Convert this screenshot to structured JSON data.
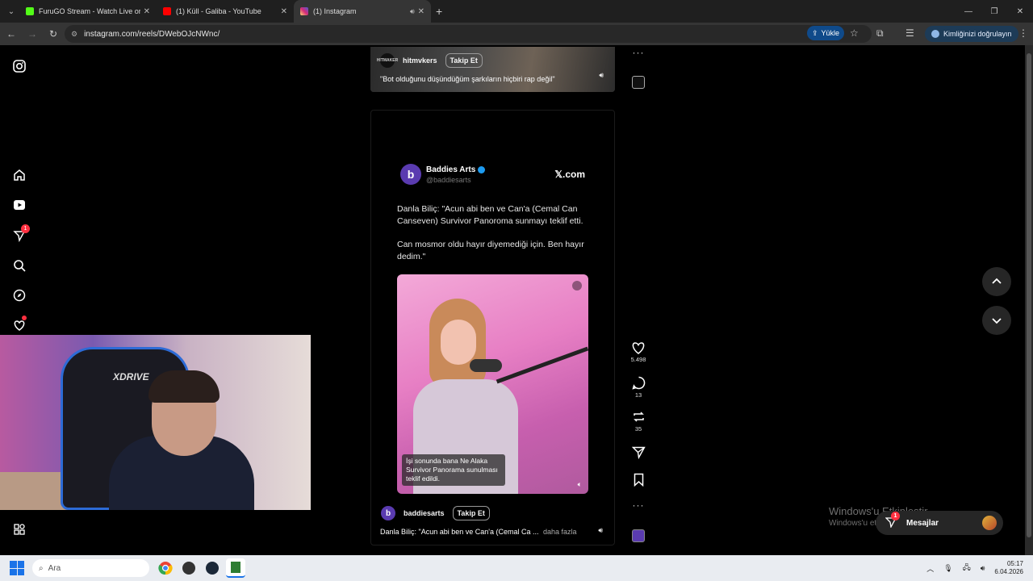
{
  "browser": {
    "tabs": [
      {
        "title": "FuruGO Stream - Watch Live or",
        "favicon_color": "#53fc18",
        "active": false
      },
      {
        "title": "(1) Küll - Galiba - YouTube",
        "favicon_color": "#ff0000",
        "active": false
      },
      {
        "title": "(1) Instagram",
        "favicon_color": "#e1306c",
        "active": true
      }
    ],
    "url": "instagram.com/reels/DWebOJcNWnc/",
    "upload_label": "Yükle",
    "verify_label": "Kimliğinizi doğrulayın"
  },
  "reel_top": {
    "username": "hitmvkers",
    "avatar_text": "HITMAKER",
    "follow_label": "Takip Et",
    "caption": "\"Bot olduğunu düşündüğüm şarkıların hiçbiri rap değil\""
  },
  "reel_main": {
    "tweet": {
      "display_name": "Baddies Arts",
      "avatar_letter": "b",
      "handle": "@baddiesarts",
      "source": "𝕏.com",
      "paragraph1": "Danla Biliç: \"Acun abi ben ve Can'a (Cemal Can Canseven) Survivor Panoroma sunmayı teklif etti.",
      "paragraph2": "Can mosmor oldu hayır diyemediği için. Ben hayır dedim.\""
    },
    "video_subtitle": "İşi sonunda bana Ne Alaka Survivor Panorama sunulması teklif edildi.",
    "username": "baddiesarts",
    "avatar_letter": "b",
    "follow_label": "Takip Et",
    "caption": "Danla Biliç: \"Acun abi ben ve Can'a (Cemal Ca ...",
    "more_label": "daha fazla"
  },
  "actions": {
    "likes": "5.498",
    "comments": "13",
    "reposts": "35"
  },
  "nav": {
    "notification_count": "1"
  },
  "webcam": {
    "chair_brand": "XDRIVE"
  },
  "overlay": {
    "watermark_title": "Windows'u Etkinleştir",
    "watermark_sub": "Windows'u etkinleştirmek için Ayarlar'a gidin.",
    "messages_label": "Mesajlar",
    "messages_badge": "1"
  },
  "taskbar": {
    "search_placeholder": "Ara",
    "time": "05:17",
    "date": "6.04.2026"
  }
}
